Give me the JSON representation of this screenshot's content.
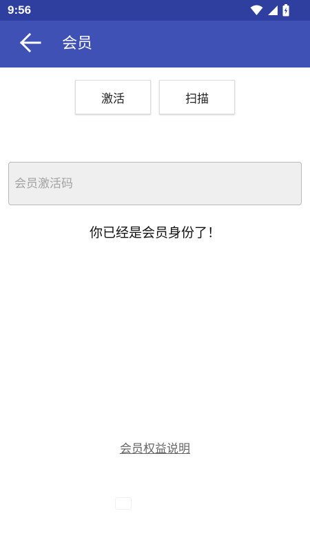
{
  "status_bar": {
    "time": "9:56",
    "icons": [
      "wifi-icon",
      "cellular-signal-icon",
      "battery-charging-icon"
    ],
    "background": "#2f3f9f"
  },
  "app_bar": {
    "title": "会员",
    "back_icon": "arrow-left-icon",
    "background": "#3f51b5"
  },
  "actions": {
    "activate_label": "激活",
    "scan_label": "扫描"
  },
  "activation_code": {
    "placeholder": "会员激活码",
    "value": ""
  },
  "member_status": "你已经是会员身份了！",
  "benefits_link": "会员权益说明"
}
